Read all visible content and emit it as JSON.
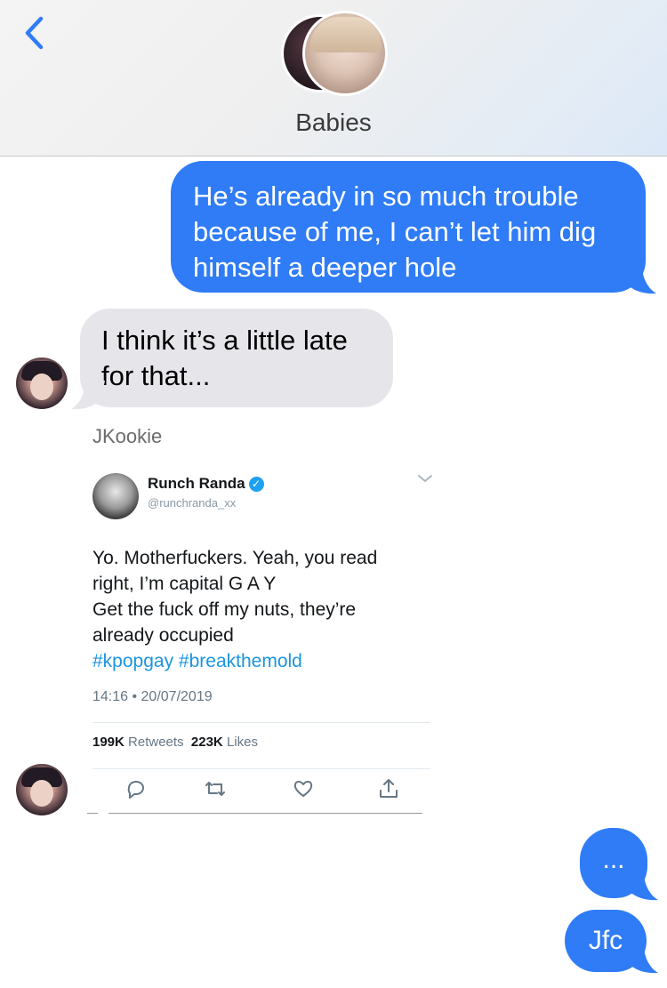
{
  "header": {
    "contact_name": "Babies",
    "accent_color": "#2f7cf6"
  },
  "messages": [
    {
      "direction": "sent",
      "lines": [
        "He’s already in so much trouble",
        "because of me, I can’t let him dig",
        "himself a deeper hole"
      ]
    },
    {
      "direction": "received",
      "lines": [
        "I think it’s a little late",
        "for that..."
      ]
    }
  ],
  "sender_label": "JKookie",
  "tweet": {
    "display_name": "Runch Randa",
    "handle": "@runchranda_xx",
    "text_lines": [
      "Yo. Motherfuckers. Yeah, you read",
      "right, I’m capital G A Y",
      "Get the fuck off my nuts, they’re",
      "already occupied"
    ],
    "hashtags": [
      "#kpopgay",
      "#breakthemold"
    ],
    "timestamp": "14:16 • 20/07/2019",
    "retweets_count": "199K",
    "retweets_label": "Retweets",
    "likes_count": "223K",
    "likes_label": "Likes",
    "hashtag_color": "#1b95e0"
  },
  "replies": [
    {
      "direction": "sent",
      "text": "..."
    },
    {
      "direction": "sent",
      "text": "Jfc"
    }
  ]
}
